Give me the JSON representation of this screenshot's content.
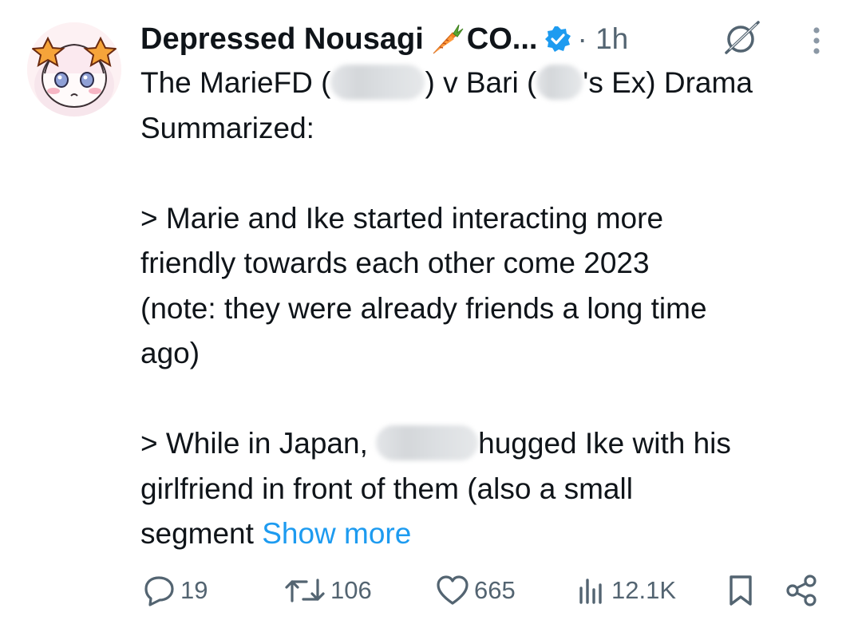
{
  "author": {
    "display_name": "Depressed Nousagi",
    "name_suffix": "CO...",
    "emoji_icon": "carrot-icon",
    "verified": true,
    "time_label": "· 1h"
  },
  "tweet": {
    "lines": [
      [
        "The MarieFD (",
        ") v Bari (",
        "'s Ex) Drama"
      ],
      "Summarized:",
      "> Marie and Ike started interacting more",
      "friendly towards each other come 2023",
      "(note: they were already friends a long time",
      "ago)",
      [
        "> While in Japan, ",
        "hugged Ike with his"
      ],
      "girlfriend in front of them (also a small",
      "segment "
    ],
    "show_more": "Show more"
  },
  "actions": {
    "replies": "19",
    "reposts": "106",
    "likes": "665",
    "views": "12.1K"
  },
  "colors": {
    "text": "#0f1419",
    "muted": "#536471",
    "link": "#1d9bf0",
    "verified": "#1d9bf0"
  }
}
